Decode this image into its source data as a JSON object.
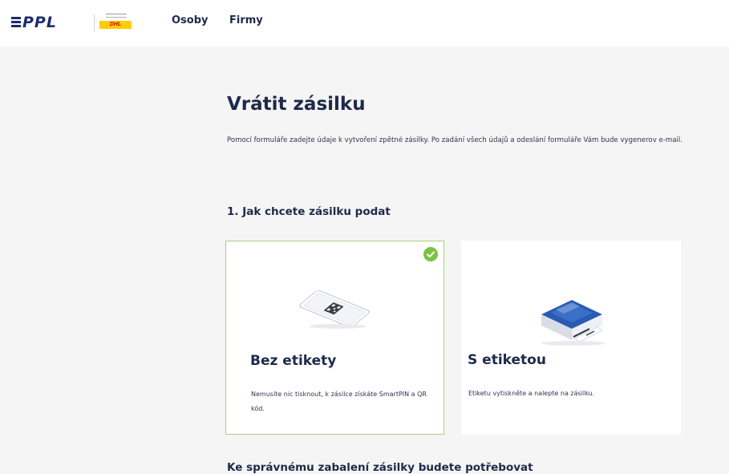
{
  "header": {
    "logo_text": "PPL",
    "dhl_text": "DHL",
    "nav": [
      {
        "label": "Osoby"
      },
      {
        "label": "Firmy"
      }
    ]
  },
  "main": {
    "title": "Vrátit zásilku",
    "intro": "Pomocí formuláře zadejte údaje k vytvoření zpětné zásilky. Po zadání všech údajů a odeslání formuláře Vám bude vygenerov e-mail.",
    "section_title": "1. Jak chcete zásilku podat",
    "options": [
      {
        "title": "Bez etikety",
        "description": "Nemusíte nic tisknout, k zásilce získáte SmartPIN a QR kód.",
        "selected": true,
        "icon": "phone-qr-icon"
      },
      {
        "title": "S etiketou",
        "description": "Etiketu vytiskněte a nalepte na zásilku.",
        "selected": false,
        "icon": "printer-icon"
      }
    ],
    "bottom_heading": "Ke správnému zabalení zásilky budete potřebovat"
  },
  "colors": {
    "brand_navy": "#1c2d6b",
    "selected_green": "#7dc242",
    "dhl_yellow": "#ffcc00",
    "dhl_red": "#d40511",
    "printer_blue": "#2a5bb0"
  }
}
